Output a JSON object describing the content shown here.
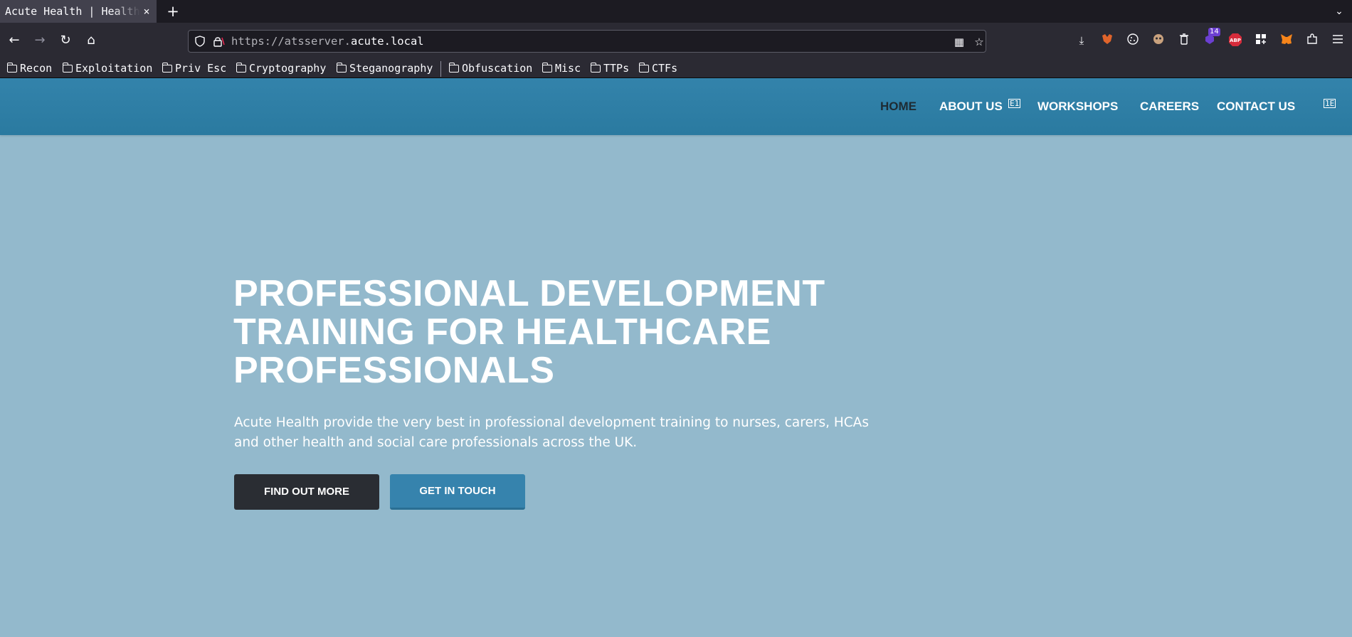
{
  "browser": {
    "tab": {
      "title": "Acute Health | Health",
      "close_glyph": "×"
    },
    "new_tab_glyph": "+",
    "tab_list_glyph": "⌄",
    "nav": {
      "back_glyph": "←",
      "forward_glyph": "→",
      "reload_glyph": "↻",
      "home_glyph": "⌂"
    },
    "url": {
      "scheme": "https://",
      "sub": "atsserver.",
      "host": "acute.local"
    },
    "url_icons": {
      "qr_glyph": "▦",
      "star_glyph": "☆"
    },
    "toolbar": {
      "download_glyph": "⤓",
      "extensions_badge": "14",
      "abp_label": "ABP",
      "icons": [
        "download-icon",
        "fox-extension-icon",
        "cookie-icon",
        "face-extension-icon",
        "trash-icon",
        "badge-extension-icon",
        "adblock-icon",
        "grid-extension-icon",
        "metamask-icon",
        "puzzle-icon",
        "menu-icon"
      ]
    },
    "bookmarks": [
      "Recon",
      "Exploitation",
      "Priv Esc",
      "Cryptography",
      "Steganography",
      "Obfuscation",
      "Misc",
      "TTPs",
      "CTFs"
    ]
  },
  "site": {
    "menu": {
      "home": "HOME",
      "about": "ABOUT US",
      "workshops": "WORKSHOPS",
      "careers": "CAREERS",
      "contact": "CONTACT US",
      "about_glyph": "E1",
      "end_glyph": "1E"
    },
    "hero": {
      "title": "PROFESSIONAL DEVELOPMENT TRAINING FOR HEALTHCARE PROFESSIONALS",
      "subtitle": "Acute Health provide the very best in professional development training to nurses, carers, HCAs and other health and social care professionals across the UK.",
      "buttons": {
        "find_out_more": "FIND OUT MORE",
        "get_in_touch": "GET IN TOUCH"
      }
    },
    "colors": {
      "header": "#2f7ea6",
      "hero_bg": "#93b9cc",
      "btn_dark": "#2a2d33",
      "btn_blue": "#3683ad"
    }
  }
}
